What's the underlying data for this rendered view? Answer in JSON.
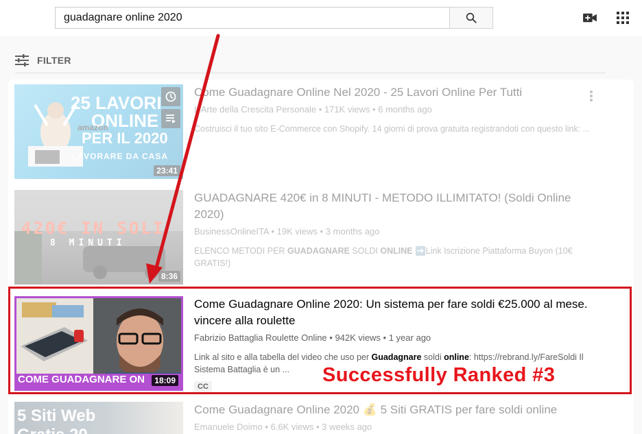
{
  "search": {
    "query": "guadagnare online 2020"
  },
  "filter": {
    "label": "FILTER"
  },
  "results": [
    {
      "title": "Come Guadagnare Online Nel 2020 - 25 Lavori Online Per Tutti",
      "channel": "L'Arte della Crescita Personale",
      "views": "171K views",
      "age": "6 months ago",
      "description": "Costruisci il tuo sito E-Commerce con Shopify. 14 giorni di prova gratuita registrandoti con questo link: ...",
      "duration": "23:41",
      "thumb_text": [
        "25 LAVORI",
        "ONLINE",
        "PER IL 2020",
        "amazon",
        "LAVORARE DA CASA"
      ]
    },
    {
      "title": "GUADAGNARE 420€ in 8 MINUTI - METODO ILLIMITATO! (Soldi Online 2020)",
      "channel": "BusinessOnlineITA",
      "views": "19K views",
      "age": "3 months ago",
      "description_parts": [
        "ELENCO METODI PER ",
        "GUADAGNARE",
        " SOLDI ",
        "ONLINE",
        " ➡️Link Iscrizione Piattaforma Buyon (10€ GRATIS!)"
      ],
      "duration": "8:36",
      "thumb_text": [
        "420€ IN SOLI",
        "8 MINUTI"
      ]
    },
    {
      "title": "Come Guadagnare Online 2020: Un sistema per fare soldi €25.000 al mese. vincere alla roulette",
      "channel": "Fabrizio Battaglia Roulette Online",
      "views": "942K views",
      "age": "1 year ago",
      "description_parts": [
        "Link al sito e alla tabella del video che uso per ",
        "Guadagnare",
        " soldi ",
        "online",
        ": https://rebrand.ly/FareSoldi Il Sistema Battaglia è un ..."
      ],
      "duration": "18:09",
      "badge": "CC",
      "thumb_text": [
        "COME GUADAGNARE ON"
      ]
    },
    {
      "title": "Come Guadagnare Online 2020 💰 5 Siti GRATIS per fare soldi online",
      "channel": "Emanuele Doimo",
      "views": "6.6K views",
      "age": "3 weeks ago",
      "thumb_text": [
        "5 Siti Web",
        "Gratis 20"
      ]
    }
  ],
  "annotation": {
    "text": "Successfully Ranked #3",
    "color": "#e8151b"
  }
}
